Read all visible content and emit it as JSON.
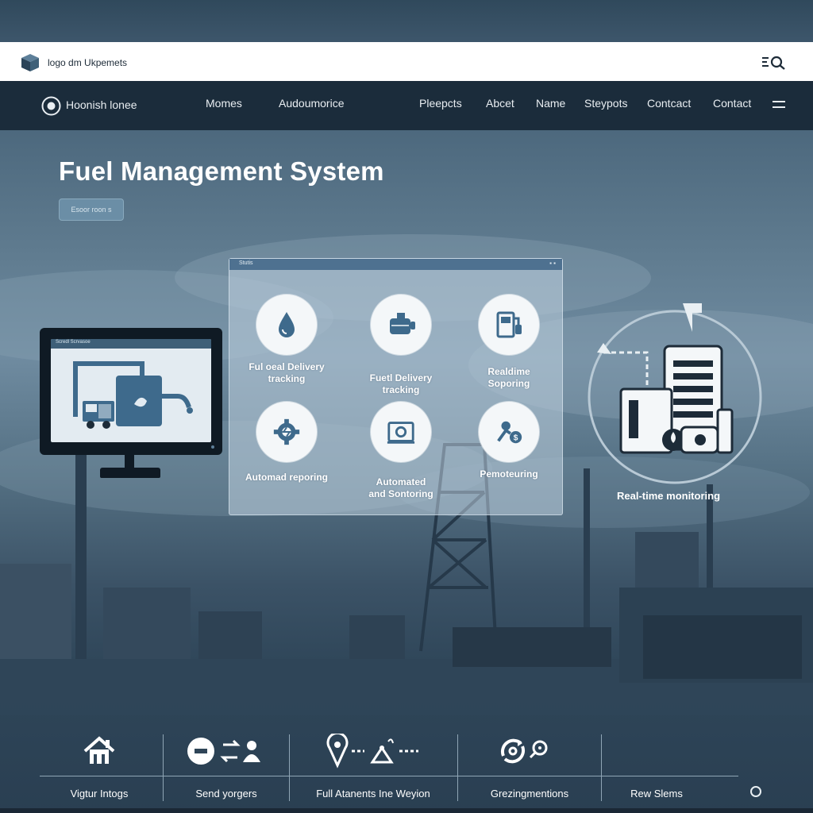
{
  "topbar": {
    "logo_text": "logo dm Ukpemets"
  },
  "nav": {
    "brand": "Hoonish lonee",
    "links": [
      "Momes",
      "Audoumorice",
      "Pleepcts",
      "Abcet",
      "Name",
      "Steypots",
      "Contcact",
      "Contact"
    ]
  },
  "hero": {
    "title": "Fuel Management System",
    "button_label": "Esoor roon s"
  },
  "panel": {
    "bar_label": "Stutis",
    "bar_dots": "▪ ▪",
    "features": [
      {
        "icon": "fuel-drop-icon",
        "label_line1": "Ful oeal Delivery",
        "label_line2": "tracking"
      },
      {
        "icon": "fuel-tank-icon",
        "label_line1": "Fuetl Delivery",
        "label_line2": "tracking"
      },
      {
        "icon": "fuel-pump-icon",
        "label_line1": "Realdime",
        "label_line2": "Soporing"
      },
      {
        "icon": "gear-icon",
        "label_line1": "Automad reporing",
        "label_line2": ""
      },
      {
        "icon": "camera-icon",
        "label_line1": "Automated",
        "label_line2": "and Sontoring"
      },
      {
        "icon": "payment-icon",
        "label_line1": "Pemoteuring",
        "label_line2": ""
      }
    ]
  },
  "monitor": {
    "topbar_text": "Scredl  Scrvasoe"
  },
  "realtime": {
    "label": "Real-time monitoring"
  },
  "bottom": {
    "items": [
      {
        "icon": "home-icon",
        "label": "Vigtur Intogs"
      },
      {
        "icon": "transfer-icon",
        "label": "Send yorgers"
      },
      {
        "icon": "route-icon",
        "label": "Full Atanents Ine Weyion"
      },
      {
        "icon": "refresh-search-icon",
        "label": "Grezingmentions"
      },
      {
        "icon": "none",
        "label": "Rew Slems"
      }
    ]
  },
  "colors": {
    "nav_bg": "#1b2c3b",
    "accent": "#3e6a8c",
    "panel_bar": "#4e7190"
  }
}
